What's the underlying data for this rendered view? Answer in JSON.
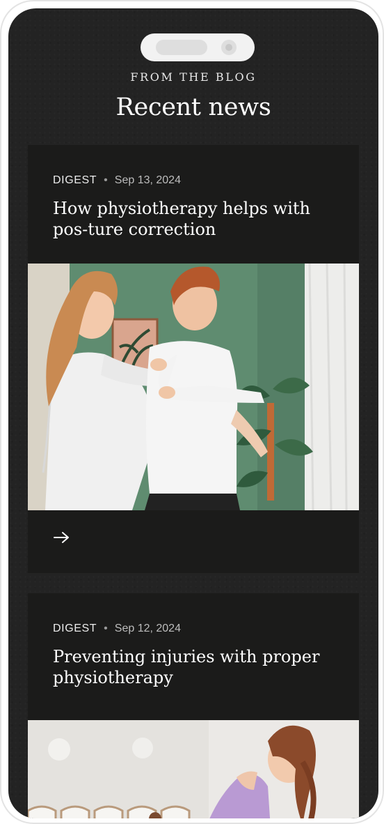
{
  "section": {
    "eyebrow": "FROM THE BLOG",
    "title": "Recent news"
  },
  "posts": [
    {
      "category": "DIGEST",
      "separator": "•",
      "date": "Sep 13, 2024",
      "title": "How physiotherapy helps with pos-ture correction",
      "link_icon": "arrow-right-icon"
    },
    {
      "category": "DIGEST",
      "separator": "•",
      "date": "Sep 12, 2024",
      "title": "Preventing injuries with proper physiotherapy"
    }
  ],
  "colors": {
    "background": "#232323",
    "card": "#1b1b1a",
    "text": "#ffffff",
    "muted": "#bdbdbd",
    "wall_green": "#5f8c70"
  }
}
